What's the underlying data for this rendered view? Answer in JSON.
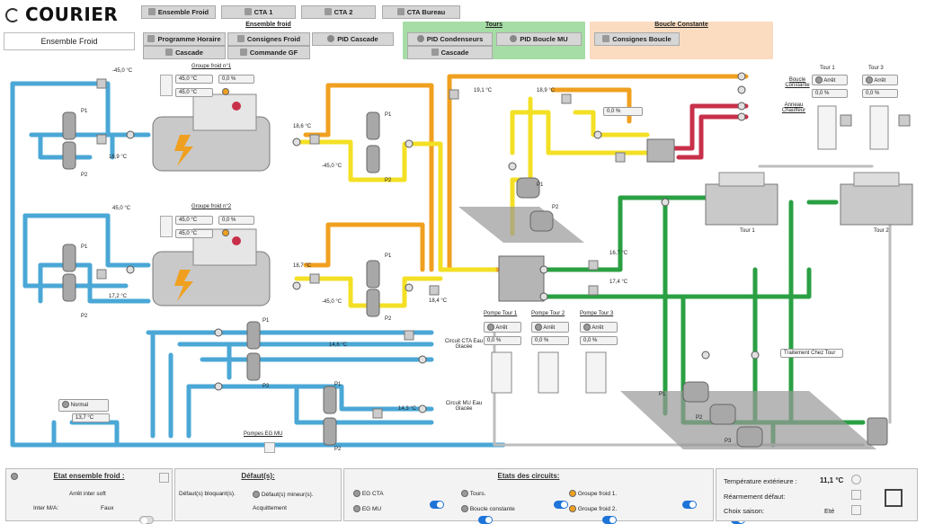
{
  "header": {
    "logo": "COURIER",
    "current_tab": "Ensemble Froid",
    "tabs": [
      "Ensemble Froid",
      "CTA 1",
      "CTA 2",
      "CTA Bureau"
    ],
    "groups": {
      "ensemble_froid": {
        "title": "Ensemble froid",
        "buttons": [
          "Programme Horaire",
          "Consignes Froid",
          "PID Cascade",
          "Cascade",
          "Commande GF"
        ]
      },
      "tours": {
        "title": "Tours",
        "buttons": [
          "PID Condenseurs",
          "PID Boucle MU",
          "Cascade"
        ]
      },
      "boucle": {
        "title": "Boucle Constante",
        "buttons": [
          "Consignes Boucle"
        ]
      }
    }
  },
  "synoptic": {
    "groupe1": {
      "title": "Groupe froid n°1",
      "cons": "45,0 °C",
      "pct": "0,0 %",
      "set": "45,0 °C"
    },
    "groupe2": {
      "title": "Groupe froid n°2",
      "cons": "45,0 °C",
      "pct": "0,0 %",
      "set": "45,0 °C"
    },
    "temps": {
      "t_top_left": "-45,0 °C",
      "t_gf1_out": "16,9 °C",
      "t_gf1_cond": "18,6 °C",
      "t_gf1_pump": "-45,0 °C",
      "t_left2": "45,0 °C",
      "t_gf2_out": "17,2 °C",
      "t_gf2_cond": "18,7 °C",
      "t_gf2_pump": "-45,0 °C",
      "t_cond_mid": "18,4 °C",
      "t_top1": "19,1 °C",
      "t_top2": "18,9 °C",
      "t_green1": "16,7 °C",
      "t_green2": "17,4 °C",
      "t_eg": "14,6 °C",
      "t_mu": "14,3 °C",
      "t_left_bottom": "13,7 °C"
    },
    "valve_pct": "0,0 %",
    "left_status": "Normal",
    "labels": {
      "p1": "P1",
      "p2": "P2",
      "boucle_constante": "Boucle Constante",
      "anneau": "Anneau Chauffeur",
      "tour1": "Tour 1",
      "tour2": "Tour 2",
      "tour3": "Tour 3",
      "tour1_bottom": "Tour 1",
      "tour2_bottom": "Tour 2",
      "circuit_cta": "Circuit CTA Eau Glacée",
      "circuit_mu": "Circuit MU Eau Glacée",
      "pompes_eg": "Pompes EG MU",
      "traitement": "Traitement Chez Tour",
      "pompe_tour1": "Pompe Tour 1",
      "pompe_tour2": "Pompe Tour 2",
      "pompe_tour3": "Pompe Tour 3",
      "arret": "Arrêt",
      "p3": "P3"
    },
    "tour_status": [
      {
        "state": "Arrêt",
        "pct": "0,0 %"
      },
      {
        "state": "Arrêt",
        "pct": "0,0 %"
      }
    ],
    "pompes": [
      {
        "state": "Arrêt",
        "pct": "0,0 %"
      },
      {
        "state": "Arrêt",
        "pct": "0,0 %"
      },
      {
        "state": "Arrêt",
        "pct": "0,0 %"
      }
    ]
  },
  "footer": {
    "etat": {
      "title": "Etat ensemble froid :",
      "l1": "Arrêt inter soft",
      "l2a": "Inter M/A:",
      "l2b": "Faux"
    },
    "defauts": {
      "title": "Défaut(s):",
      "a": "Défaut(s) bloquant(s).",
      "b": "Défaut(s) mineur(s).",
      "c": "Acquittement"
    },
    "circuits": {
      "title": "Etats des circuits:",
      "items": [
        "EG CTA",
        "Tours.",
        "Groupe froid 1.",
        "EG MU",
        "Boucle constante",
        "Groupe froid 2."
      ]
    },
    "infos": {
      "temp_label": "Température extérieure :",
      "temp_val": "11,1 °C",
      "rearm": "Réarmement défaut:",
      "saison_label": "Choix saison:",
      "saison_val": "Eté"
    }
  },
  "colors": {
    "blue": "#4aa7d6",
    "yellow": "#f3e024",
    "orange": "#f0a020",
    "green": "#2aa043",
    "red": "#c8304a",
    "grey": "#bdbdbd"
  }
}
